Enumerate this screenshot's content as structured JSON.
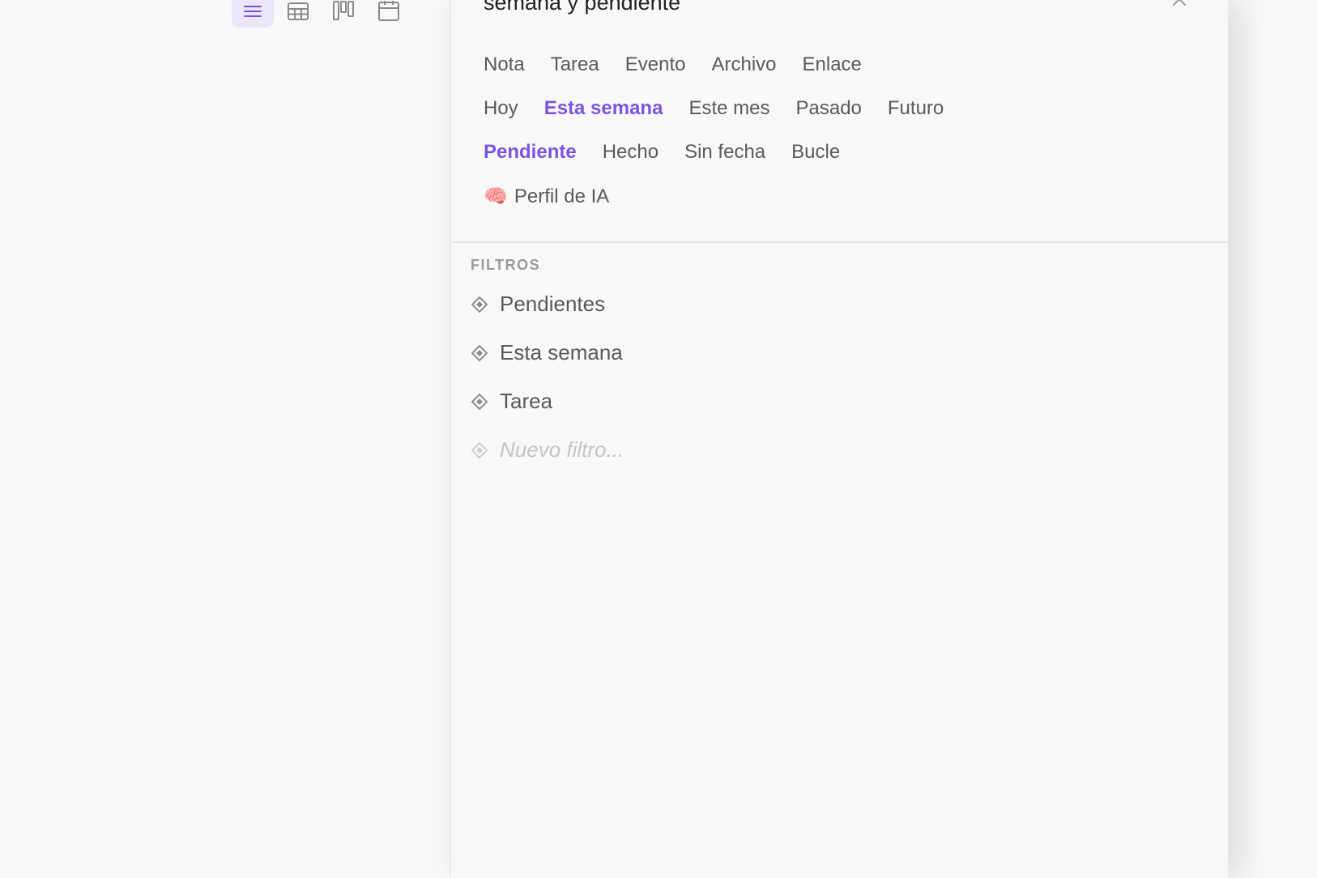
{
  "panel": {
    "title": "semana y pendiente"
  },
  "types": [
    {
      "label": "Nota",
      "active": false
    },
    {
      "label": "Tarea",
      "active": false
    },
    {
      "label": "Evento",
      "active": false
    },
    {
      "label": "Archivo",
      "active": false
    },
    {
      "label": "Enlace",
      "active": false
    }
  ],
  "dates": [
    {
      "label": "Hoy",
      "active": false
    },
    {
      "label": "Esta semana",
      "active": true
    },
    {
      "label": "Este mes",
      "active": false
    },
    {
      "label": "Pasado",
      "active": false
    },
    {
      "label": "Futuro",
      "active": false
    }
  ],
  "statuses": [
    {
      "label": "Pendiente",
      "active": true
    },
    {
      "label": "Hecho",
      "active": false
    },
    {
      "label": "Sin fecha",
      "active": false
    },
    {
      "label": "Bucle",
      "active": false
    }
  ],
  "ai_profile": {
    "emoji": "🧠",
    "label": "Perfil de IA"
  },
  "filters": {
    "header": "FILTROS",
    "items": [
      "Pendientes",
      "Esta semana",
      "Tarea"
    ],
    "new_placeholder": "Nuevo filtro..."
  },
  "view_switcher": {
    "items": [
      "list-view",
      "table-view",
      "board-view",
      "calendar-view"
    ],
    "active": "list-view"
  },
  "colors": {
    "accent": "#7b54e0",
    "accent_bg": "#ece6fb",
    "text": "#5a5a5a",
    "muted": "#9a9a9a"
  }
}
